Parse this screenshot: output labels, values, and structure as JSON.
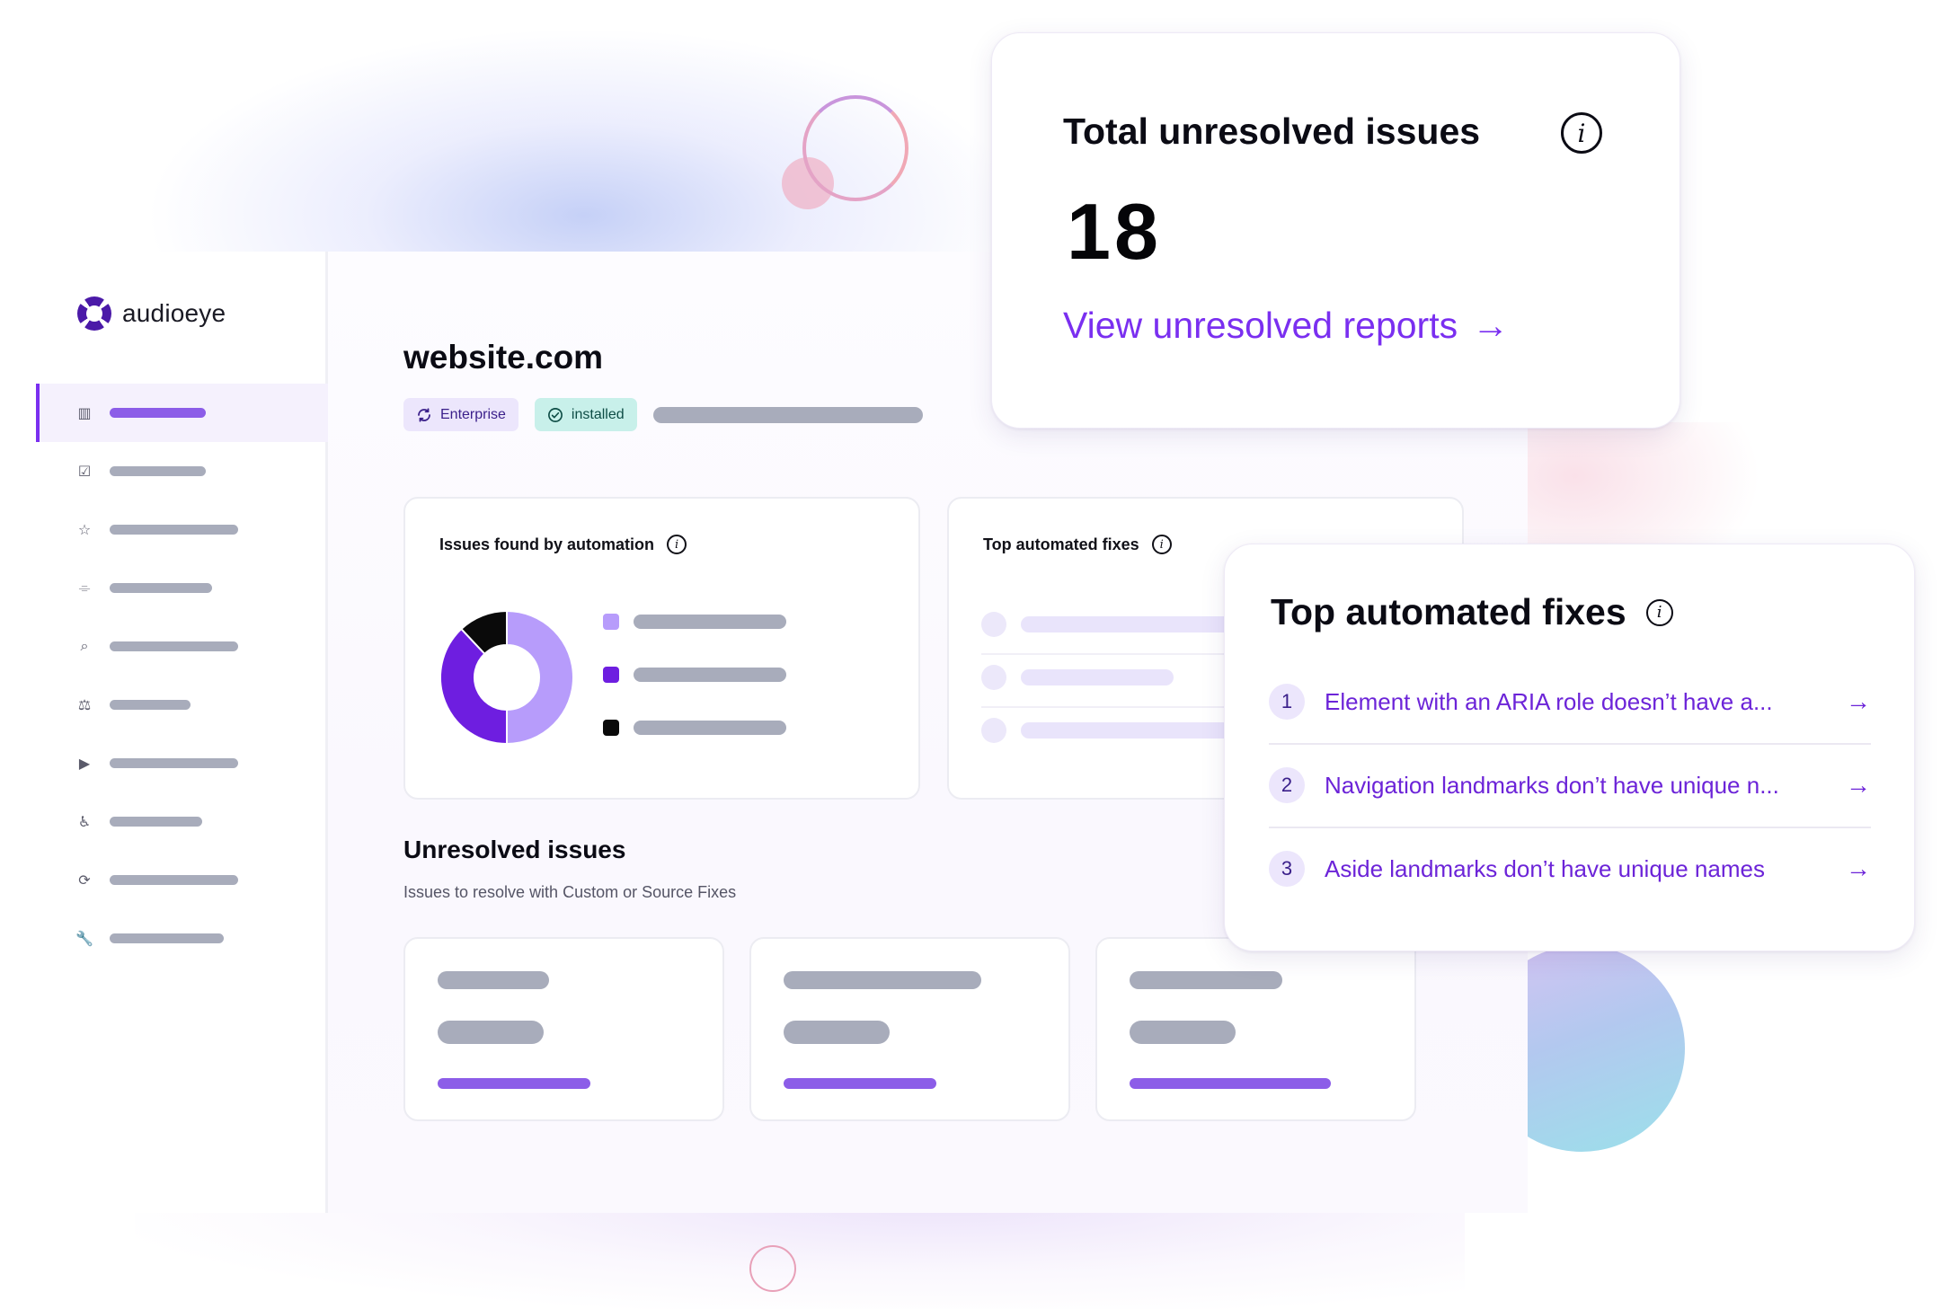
{
  "brand": {
    "name": "audioeye",
    "logo_icon": "audioeye-logo-icon",
    "accent": "#7a2ff0"
  },
  "sidebar": {
    "items": [
      {
        "icon": "bar-chart-icon",
        "glyph": "▥",
        "active": true
      },
      {
        "icon": "clipboard-icon",
        "glyph": "☑",
        "active": false
      },
      {
        "icon": "star-icon",
        "glyph": "☆",
        "active": false
      },
      {
        "icon": "scroll-icon",
        "glyph": "⌯",
        "active": false
      },
      {
        "icon": "search-doc-icon",
        "glyph": "⌕",
        "active": false
      },
      {
        "icon": "scales-icon",
        "glyph": "⚖",
        "active": false
      },
      {
        "icon": "play-icon",
        "glyph": "▶",
        "active": false
      },
      {
        "icon": "accessibility-icon",
        "glyph": "♿",
        "active": false
      },
      {
        "icon": "refresh-icon",
        "glyph": "⟳",
        "active": false
      },
      {
        "icon": "wrench-icon",
        "glyph": "🔧",
        "active": false
      }
    ]
  },
  "site": {
    "title": "website.com",
    "plan_badge": "Enterprise",
    "status_badge": "installed"
  },
  "automation_card": {
    "title": "Issues found by automation",
    "donut": {
      "type": "pie",
      "values": [
        50,
        38,
        12
      ],
      "colors": [
        "#b79cfb",
        "#6e1ee0",
        "#0a0a0a"
      ]
    },
    "legend_colors": [
      "#b79cfb",
      "#6e1ee0",
      "#0a0a0a"
    ]
  },
  "fixes_card_bg": {
    "title": "Top automated fixes"
  },
  "unresolved": {
    "title": "Unresolved issues",
    "subtitle": "Issues to resolve with Custom or Source Fixes"
  },
  "total_card": {
    "title": "Total unresolved issues",
    "count": "18",
    "link": "View unresolved reports",
    "link_arrow": "→"
  },
  "top_fixes": {
    "title": "Top automated fixes",
    "items": [
      {
        "num": "1",
        "text": "Element with an ARIA role doesn’t have a..."
      },
      {
        "num": "2",
        "text": "Navigation landmarks don’t have unique n..."
      },
      {
        "num": "3",
        "text": "Aside landmarks don’t have unique names"
      }
    ],
    "arrow": "→"
  }
}
